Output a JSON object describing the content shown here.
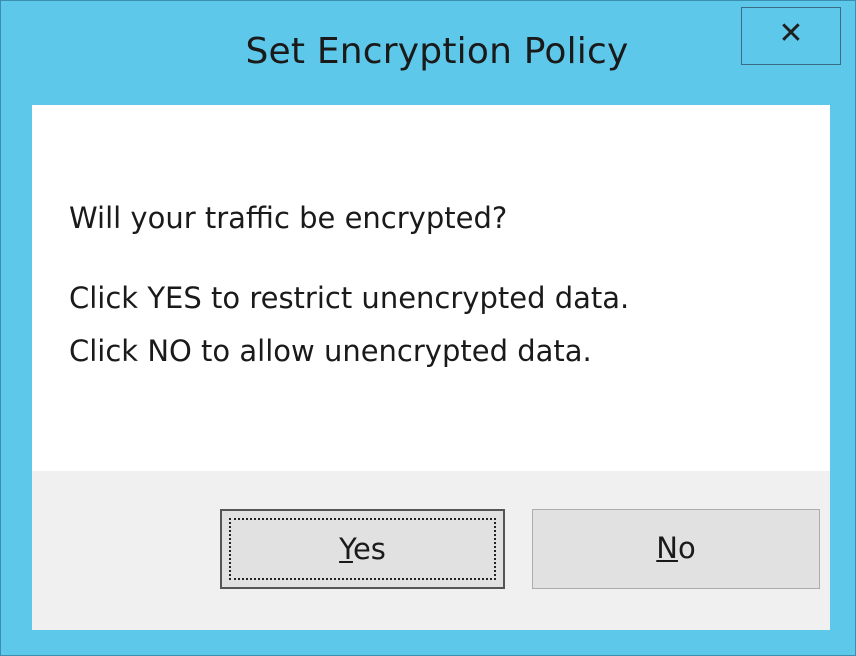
{
  "dialog": {
    "title": "Set Encryption Policy",
    "close_symbol": "✕",
    "question": "Will your traffic be encrypted?",
    "line_yes": "Click YES to restrict unencrypted data.",
    "line_no": "Click NO to allow unencrypted data."
  },
  "buttons": {
    "yes": {
      "mnemonic": "Y",
      "rest": "es"
    },
    "no": {
      "mnemonic": "N",
      "rest": "o"
    }
  },
  "colors": {
    "frame": "#5ec8ea",
    "client": "#ffffff",
    "button_bar": "#f0f0f0",
    "button_face": "#e1e1e1"
  }
}
